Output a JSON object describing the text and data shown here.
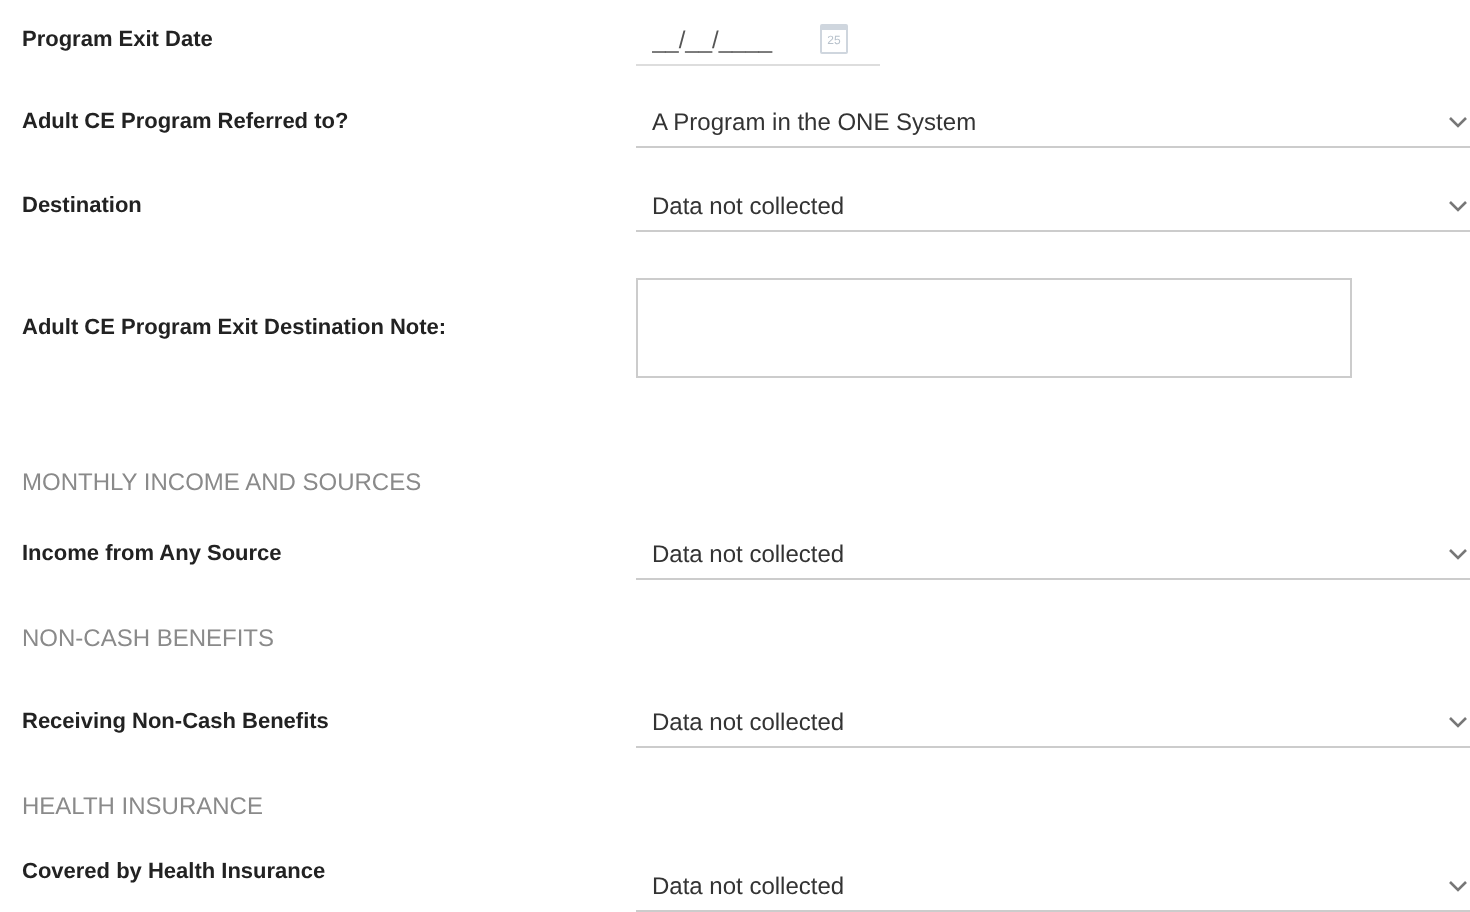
{
  "fields": [
    {
      "kind": "date",
      "label": "Program Exit Date",
      "placeholder": "__/__/____",
      "calendar_day": "25"
    },
    {
      "kind": "select",
      "label": "Adult CE Program Referred to?",
      "value": "A Program in the ONE System"
    },
    {
      "kind": "select",
      "label": "Destination",
      "value": "Data not collected"
    },
    {
      "kind": "textarea",
      "label": "Adult CE Program Exit Destination Note:"
    },
    {
      "kind": "heading",
      "label": "MONTHLY INCOME AND SOURCES"
    },
    {
      "kind": "select",
      "label": "Income from Any Source",
      "value": "Data not collected"
    },
    {
      "kind": "heading",
      "label": "NON-CASH BENEFITS"
    },
    {
      "kind": "select",
      "label": "Receiving Non-Cash Benefits",
      "value": "Data not collected"
    },
    {
      "kind": "heading",
      "label": "HEALTH INSURANCE"
    },
    {
      "kind": "select",
      "label": "Covered by Health Insurance",
      "value": "Data not collected"
    }
  ]
}
